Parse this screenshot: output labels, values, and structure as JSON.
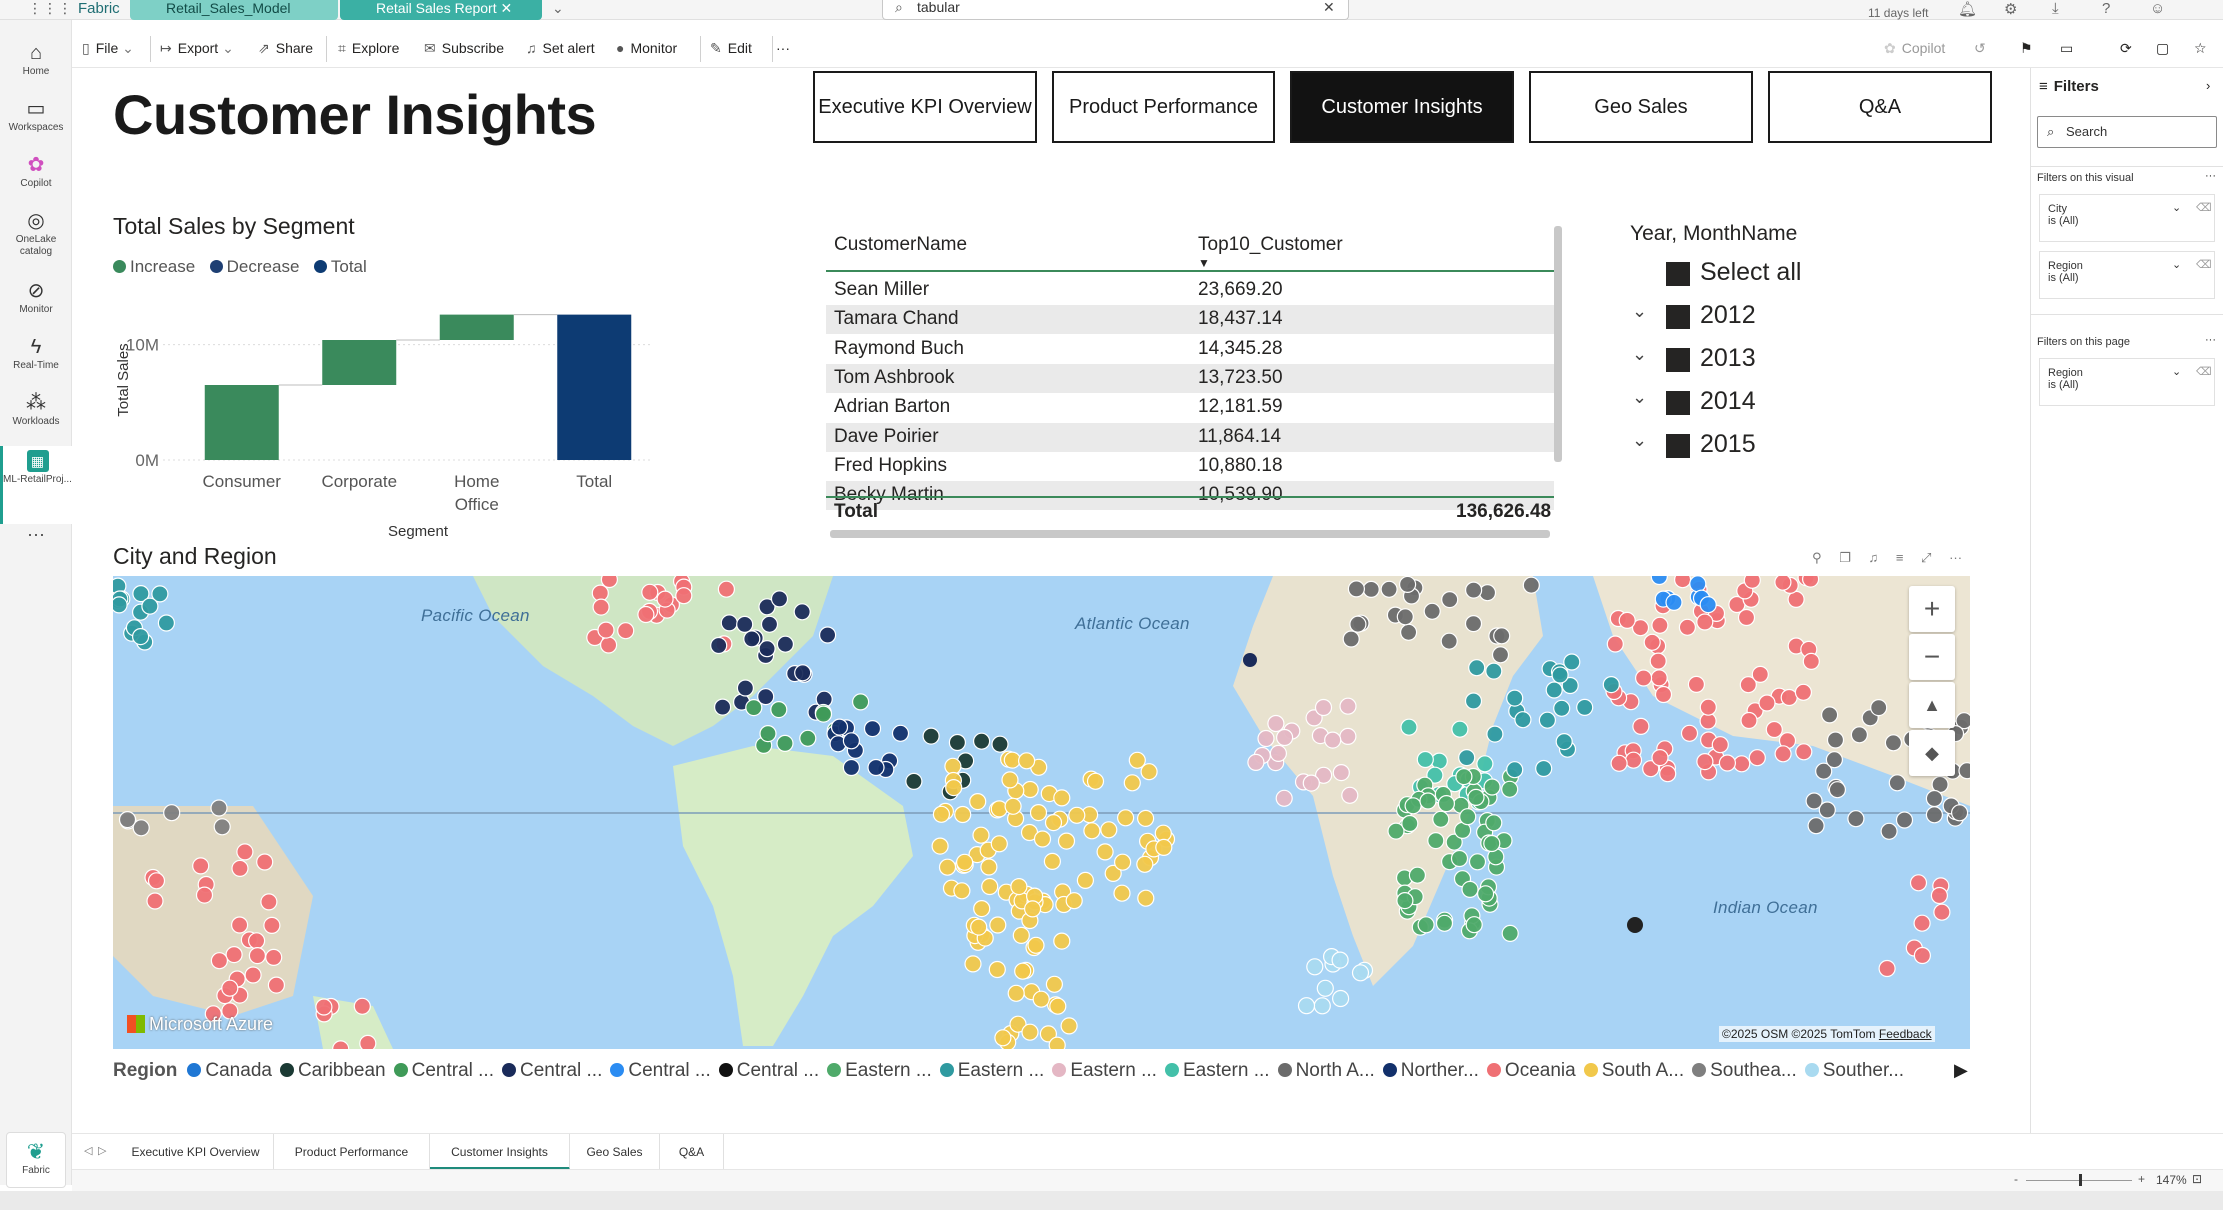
{
  "topbar": {
    "brand": "Fabric",
    "tabs": [
      "Retail_Sales_Model",
      "Retail Sales Report"
    ],
    "search_value": "tabular",
    "trial": "11 days left"
  },
  "left_rail": [
    {
      "label": "Home",
      "icon": "home-icon"
    },
    {
      "label": "Workspaces",
      "icon": "workspaces-icon"
    },
    {
      "label": "Copilot",
      "icon": "copilot-icon"
    },
    {
      "label": "OneLake catalog",
      "icon": "onelake-icon"
    },
    {
      "label": "Monitor",
      "icon": "monitor-icon"
    },
    {
      "label": "Real-Time",
      "icon": "realtime-icon"
    },
    {
      "label": "Workloads",
      "icon": "workloads-icon"
    },
    {
      "label": "ML-RetailProj...",
      "icon": "ml-project-icon"
    },
    {
      "label": "···",
      "icon": "more-icon"
    }
  ],
  "toolbar": {
    "file": "File",
    "export": "Export",
    "share": "Share",
    "explore": "Explore",
    "subscribe": "Subscribe",
    "set_alert": "Set alert",
    "monitor": "Monitor",
    "edit": "Edit",
    "more": "···",
    "copilot": "Copilot"
  },
  "page": {
    "title": "Customer Insights",
    "nav_buttons": [
      "Executive KPI Overview",
      "Product Performance",
      "Customer Insights",
      "Geo Sales",
      "Q&A"
    ],
    "active_nav": "Customer Insights"
  },
  "waterfall": {
    "title": "Total Sales by Segment",
    "legend": [
      {
        "label": "Increase",
        "color": "#3a8a5c"
      },
      {
        "label": "Decrease",
        "color": "#1e3f73"
      },
      {
        "label": "Total",
        "color": "#0d3b73"
      }
    ],
    "ylabel": "Total Sales",
    "xlabel": "Segment",
    "yticks": [
      "10M",
      "0M"
    ]
  },
  "chart_data": {
    "type": "bar",
    "subtype": "waterfall",
    "title": "Total Sales by Segment",
    "xlabel": "Segment",
    "ylabel": "Total Sales",
    "categories": [
      "Consumer",
      "Corporate",
      "Home Office",
      "Total"
    ],
    "values": [
      6.5,
      3.9,
      2.2,
      12.6
    ],
    "value_unit": "M",
    "ylim": [
      0,
      13
    ]
  },
  "table": {
    "col1": "CustomerName",
    "col2": "Top10_Customer",
    "rows": [
      {
        "name": "Sean Miller",
        "value": "23,669.20"
      },
      {
        "name": "Tamara Chand",
        "value": "18,437.14"
      },
      {
        "name": "Raymond Buch",
        "value": "14,345.28"
      },
      {
        "name": "Tom Ashbrook",
        "value": "13,723.50"
      },
      {
        "name": "Adrian Barton",
        "value": "12,181.59"
      },
      {
        "name": "Dave Poirier",
        "value": "11,864.14"
      },
      {
        "name": "Fred Hopkins",
        "value": "10,880.18"
      },
      {
        "name": "Becky Martin",
        "value": "10,539.90"
      }
    ],
    "total_label": "Total",
    "total_value": "136,626.48"
  },
  "slicer": {
    "title": "Year, MonthName",
    "items": [
      "Select all",
      "2012",
      "2013",
      "2014",
      "2015"
    ]
  },
  "map": {
    "title": "City and Region",
    "oceans": [
      "Pacific Ocean",
      "Atlantic Ocean",
      "Indian Ocean"
    ],
    "watermark": "Microsoft Azure",
    "attribution": "©2025 OSM  ©2025 TomTom",
    "feedback": "Feedback",
    "legend_label": "Region",
    "legend": [
      {
        "label": "Canada",
        "color": "#1f77d4"
      },
      {
        "label": "Caribbean",
        "color": "#1b3a34"
      },
      {
        "label": "Central ...",
        "color": "#3f9a58"
      },
      {
        "label": "Central ...",
        "color": "#1a2b5a"
      },
      {
        "label": "Central ...",
        "color": "#2b8cf2"
      },
      {
        "label": "Central ...",
        "color": "#111111"
      },
      {
        "label": "Eastern ...",
        "color": "#4faa6a"
      },
      {
        "label": "Eastern ...",
        "color": "#2f9aa0"
      },
      {
        "label": "Eastern ...",
        "color": "#e4b7c4"
      },
      {
        "label": "Eastern ...",
        "color": "#43c0a9"
      },
      {
        "label": "North A...",
        "color": "#6b6b6b"
      },
      {
        "label": "Norther...",
        "color": "#12306b"
      },
      {
        "label": "Oceania",
        "color": "#ef7074"
      },
      {
        "label": "South A...",
        "color": "#f1c84b"
      },
      {
        "label": "Southea...",
        "color": "#7f7f7f"
      },
      {
        "label": "Souther...",
        "color": "#a9daf0"
      }
    ]
  },
  "filters": {
    "title": "Filters",
    "search_placeholder": "Search",
    "on_visual_label": "Filters on this visual",
    "on_page_label": "Filters on this page",
    "visual_filters": [
      {
        "field": "City",
        "state": "is (All)"
      },
      {
        "field": "Region",
        "state": "is (All)"
      }
    ],
    "page_filters": [
      {
        "field": "Region",
        "state": "is (All)"
      }
    ]
  },
  "bottom_tabs": [
    "Executive KPI Overview",
    "Product Performance",
    "Customer Insights",
    "Geo Sales",
    "Q&A"
  ],
  "active_bottom_tab": "Customer Insights",
  "status": {
    "zoom": "147%",
    "fabric_label": "Fabric"
  }
}
